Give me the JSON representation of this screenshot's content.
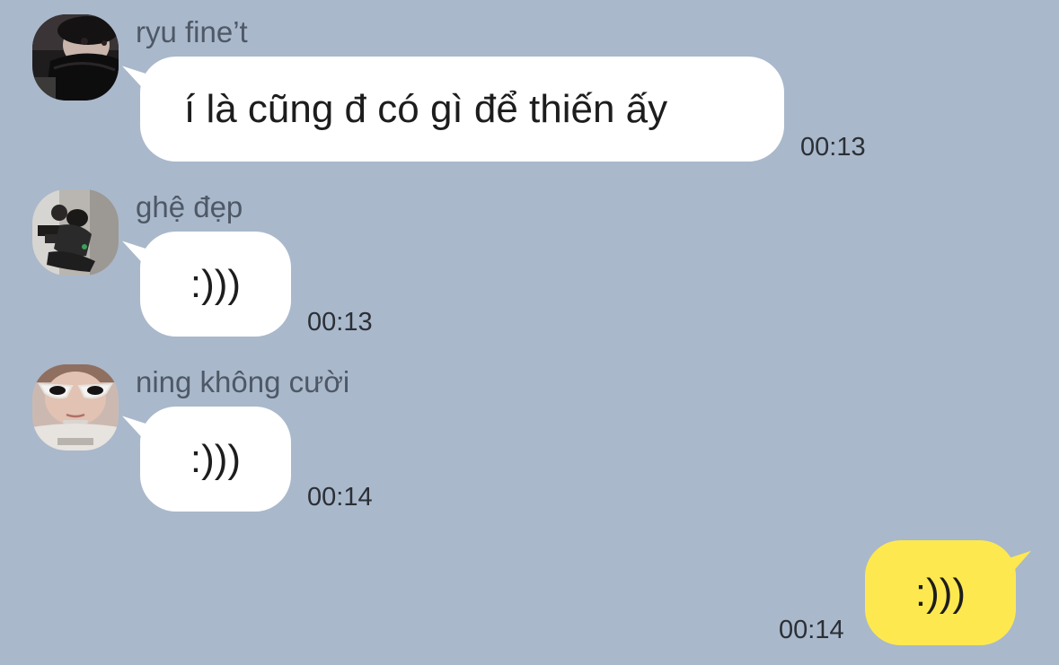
{
  "messages": [
    {
      "sender": "ryu fine’t",
      "text": "í là cũng đ có gì để thiến ấy",
      "time": "00:13",
      "avatar_icon": "avatar-photo-masked-person"
    },
    {
      "sender": "ghệ đẹp",
      "text": ":)))",
      "time": "00:13",
      "avatar_icon": "avatar-photo-sitting-person"
    },
    {
      "sender": "ning không cười",
      "text": ":)))",
      "time": "00:14",
      "avatar_icon": "avatar-photo-sunglasses-person"
    }
  ],
  "my_message": {
    "text": ":)))",
    "time": "00:14"
  },
  "colors": {
    "background": "#a9b8cb",
    "incoming_bubble": "#ffffff",
    "outgoing_bubble": "#fde94f"
  }
}
